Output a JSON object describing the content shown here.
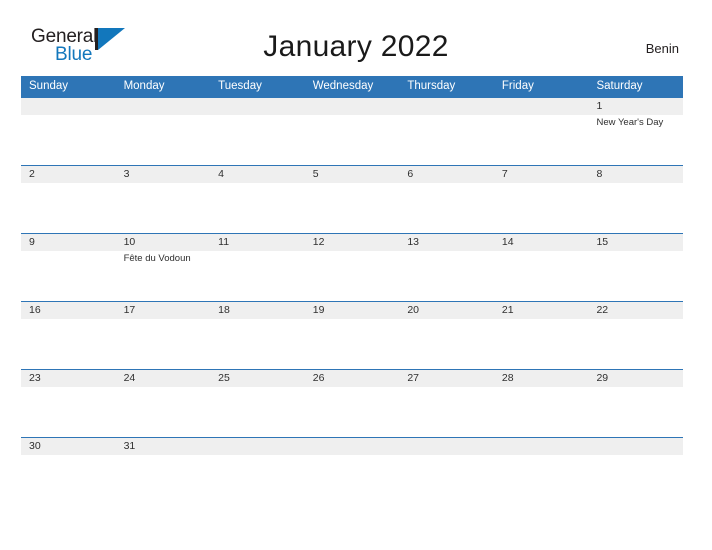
{
  "brand": {
    "name_part1": "General",
    "name_part2": "Blue",
    "logo_icon": "flag-triangle-icon",
    "color_dark": "#231f20",
    "color_blue": "#1277bc"
  },
  "header": {
    "title": "January 2022",
    "region": "Benin"
  },
  "theme": {
    "header_blue": "#2e75b6",
    "row_gray": "#efefef",
    "rule_blue": "#2e75b6",
    "text_dark": "#2f2f2f"
  },
  "calendar": {
    "month": "January",
    "year": "2022",
    "weekdays": [
      "Sunday",
      "Monday",
      "Tuesday",
      "Wednesday",
      "Thursday",
      "Friday",
      "Saturday"
    ],
    "weeks": [
      {
        "days": [
          {
            "number": "",
            "event": ""
          },
          {
            "number": "",
            "event": ""
          },
          {
            "number": "",
            "event": ""
          },
          {
            "number": "",
            "event": ""
          },
          {
            "number": "",
            "event": ""
          },
          {
            "number": "",
            "event": ""
          },
          {
            "number": "1",
            "event": "New Year's Day"
          }
        ]
      },
      {
        "days": [
          {
            "number": "2",
            "event": ""
          },
          {
            "number": "3",
            "event": ""
          },
          {
            "number": "4",
            "event": ""
          },
          {
            "number": "5",
            "event": ""
          },
          {
            "number": "6",
            "event": ""
          },
          {
            "number": "7",
            "event": ""
          },
          {
            "number": "8",
            "event": ""
          }
        ]
      },
      {
        "days": [
          {
            "number": "9",
            "event": ""
          },
          {
            "number": "10",
            "event": "Fête du Vodoun"
          },
          {
            "number": "11",
            "event": ""
          },
          {
            "number": "12",
            "event": ""
          },
          {
            "number": "13",
            "event": ""
          },
          {
            "number": "14",
            "event": ""
          },
          {
            "number": "15",
            "event": ""
          }
        ]
      },
      {
        "days": [
          {
            "number": "16",
            "event": ""
          },
          {
            "number": "17",
            "event": ""
          },
          {
            "number": "18",
            "event": ""
          },
          {
            "number": "19",
            "event": ""
          },
          {
            "number": "20",
            "event": ""
          },
          {
            "number": "21",
            "event": ""
          },
          {
            "number": "22",
            "event": ""
          }
        ]
      },
      {
        "days": [
          {
            "number": "23",
            "event": ""
          },
          {
            "number": "24",
            "event": ""
          },
          {
            "number": "25",
            "event": ""
          },
          {
            "number": "26",
            "event": ""
          },
          {
            "number": "27",
            "event": ""
          },
          {
            "number": "28",
            "event": ""
          },
          {
            "number": "29",
            "event": ""
          }
        ]
      },
      {
        "days": [
          {
            "number": "30",
            "event": ""
          },
          {
            "number": "31",
            "event": ""
          },
          {
            "number": "",
            "event": ""
          },
          {
            "number": "",
            "event": ""
          },
          {
            "number": "",
            "event": ""
          },
          {
            "number": "",
            "event": ""
          },
          {
            "number": "",
            "event": ""
          }
        ]
      }
    ]
  }
}
